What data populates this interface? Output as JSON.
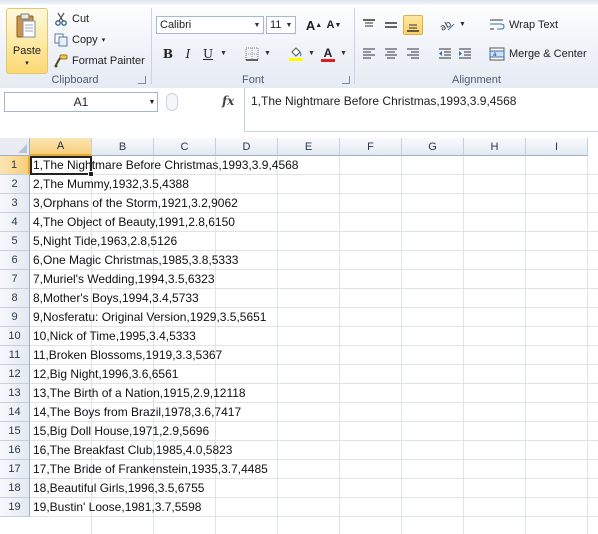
{
  "ribbon": {
    "clipboard": {
      "paste_label": "Paste",
      "paste_arrow": "▾",
      "cut_label": "Cut",
      "copy_label": "Copy",
      "copy_arrow": "▾",
      "format_painter_label": "Format Painter",
      "group_label": "Clipboard"
    },
    "font": {
      "font_name": "Calibri",
      "font_size": "11",
      "grow_font": "A",
      "shrink_font": "A",
      "bold": "B",
      "italic": "I",
      "underline": "U",
      "font_color_letter": "A",
      "group_label": "Font",
      "highlight_color": "#ffff00",
      "font_color": "#e02020"
    },
    "alignment": {
      "wrap_text_label": "Wrap Text",
      "merge_center_label": "Merge & Center",
      "group_label": "Alignment"
    }
  },
  "formula_bar": {
    "name_box": "A1",
    "fx": "fx",
    "content": "1,The Nightmare Before Christmas,1993,3.9,4568"
  },
  "sheet": {
    "columns": [
      "A",
      "B",
      "C",
      "D",
      "E",
      "F",
      "G",
      "H",
      "I"
    ],
    "selected_column": "A",
    "selected_row": "1",
    "rows": [
      {
        "num": "1",
        "text": "1,The Nightmare Before Christmas,1993,3.9,4568"
      },
      {
        "num": "2",
        "text": "2,The Mummy,1932,3.5,4388"
      },
      {
        "num": "3",
        "text": "3,Orphans of the Storm,1921,3.2,9062"
      },
      {
        "num": "4",
        "text": "4,The Object of Beauty,1991,2.8,6150"
      },
      {
        "num": "5",
        "text": "5,Night Tide,1963,2.8,5126"
      },
      {
        "num": "6",
        "text": "6,One Magic Christmas,1985,3.8,5333"
      },
      {
        "num": "7",
        "text": "7,Muriel's Wedding,1994,3.5,6323"
      },
      {
        "num": "8",
        "text": "8,Mother's Boys,1994,3.4,5733"
      },
      {
        "num": "9",
        "text": "9,Nosferatu: Original Version,1929,3.5,5651"
      },
      {
        "num": "10",
        "text": "10,Nick of Time,1995,3.4,5333"
      },
      {
        "num": "11",
        "text": "11,Broken Blossoms,1919,3.3,5367"
      },
      {
        "num": "12",
        "text": "12,Big Night,1996,3.6,6561"
      },
      {
        "num": "13",
        "text": "13,The Birth of a Nation,1915,2.9,12118"
      },
      {
        "num": "14",
        "text": "14,The Boys from Brazil,1978,3.6,7417"
      },
      {
        "num": "15",
        "text": "15,Big Doll House,1971,2.9,5696"
      },
      {
        "num": "16",
        "text": "16,The Breakfast Club,1985,4.0,5823"
      },
      {
        "num": "17",
        "text": "17,The Bride of Frankenstein,1935,3.7,4485"
      },
      {
        "num": "18",
        "text": "18,Beautiful Girls,1996,3.5,6755"
      },
      {
        "num": "19",
        "text": "19,Bustin' Loose,1981,3.7,5598"
      }
    ]
  }
}
